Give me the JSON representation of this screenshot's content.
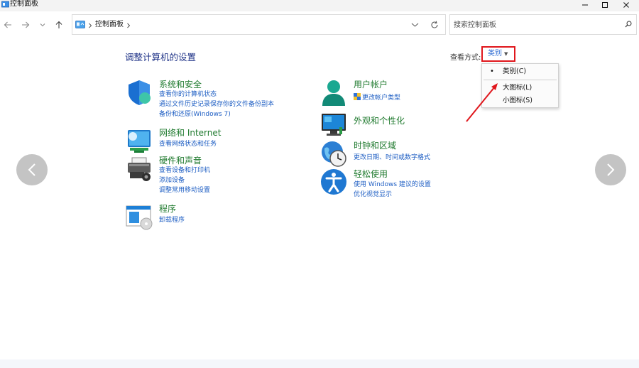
{
  "window": {
    "title": "控制面板"
  },
  "address": {
    "crumb": "控制面板"
  },
  "search": {
    "placeholder": "搜索控制面板"
  },
  "main": {
    "page_title": "调整计算机的设置",
    "view_by_label": "查看方式:",
    "view_by_value": "类别",
    "view_menu": [
      {
        "label": "类别(C)",
        "selected": true
      },
      {
        "label": "大图标(L)",
        "selected": false
      },
      {
        "label": "小图标(S)",
        "selected": false
      }
    ]
  },
  "categories": {
    "system": {
      "title": "系统和安全",
      "links": [
        "查看你的计算机状态",
        "通过文件历史记录保存你的文件备份副本",
        "备份和还原(Windows 7)"
      ]
    },
    "network": {
      "title": "网络和 Internet",
      "links": [
        "查看网络状态和任务"
      ]
    },
    "hardware": {
      "title": "硬件和声音",
      "links": [
        "查看设备和打印机",
        "添加设备",
        "调整常用移动设置"
      ]
    },
    "programs": {
      "title": "程序",
      "links": [
        "卸载程序"
      ]
    },
    "users": {
      "title": "用户帐户",
      "links": [
        "更改帐户类型"
      ]
    },
    "appearance": {
      "title": "外观和个性化",
      "links": []
    },
    "clock": {
      "title": "时钟和区域",
      "links": [
        "更改日期、时间或数字格式"
      ]
    },
    "ease": {
      "title": "轻松使用",
      "links": [
        "使用 Windows 建议的设置",
        "优化视觉显示"
      ]
    }
  },
  "colors": {
    "accent_link": "#2160c4",
    "category_title": "#1f7a2e",
    "highlight_box": "#e0161c",
    "arrow": "#e0161c"
  }
}
